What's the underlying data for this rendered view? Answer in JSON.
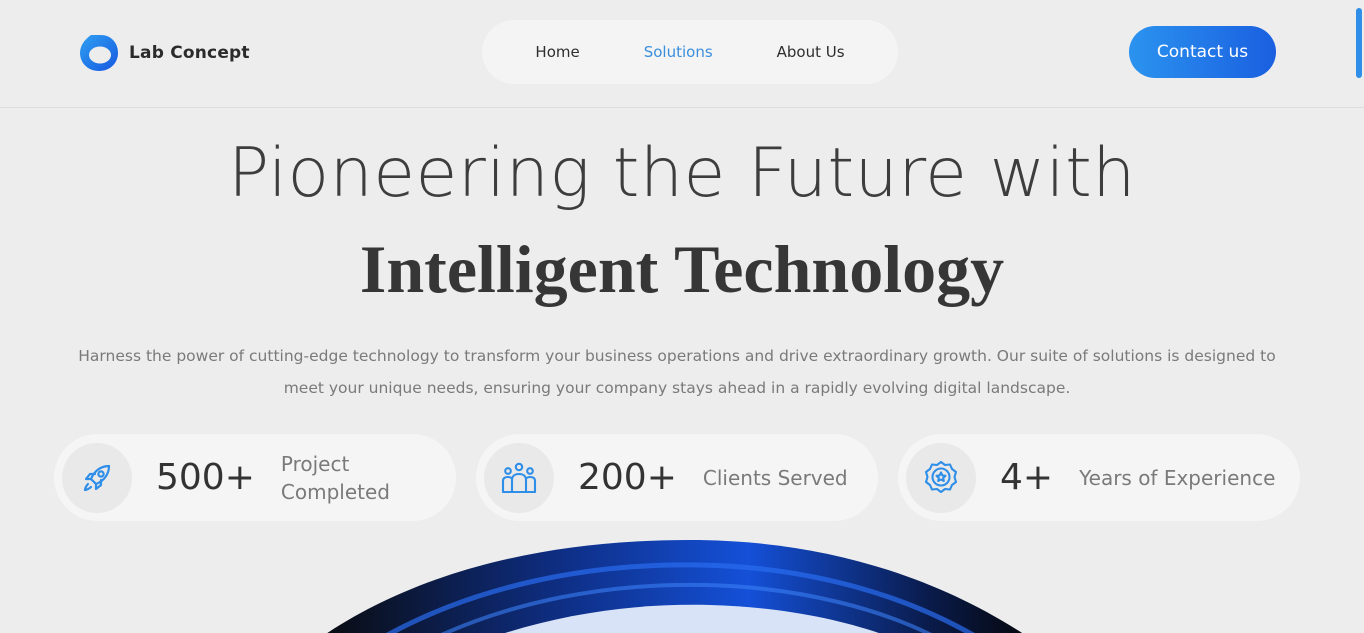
{
  "header": {
    "logo_text": "Lab Concept",
    "nav": [
      "Home",
      "Solutions",
      "About Us"
    ],
    "active_nav": "Solutions",
    "contact_label": "Contact us"
  },
  "hero": {
    "line1": "Pioneering the Future with",
    "line2": "Intelligent Technology",
    "description": "Harness the power of cutting-edge technology to transform your business operations and drive extraordinary growth. Our suite of solutions is designed to meet your unique needs, ensuring your company stays ahead in a rapidly evolving digital landscape."
  },
  "stats": [
    {
      "icon": "rocket-icon",
      "value": "500+",
      "label": "Project Completed"
    },
    {
      "icon": "clients-icon",
      "value": "200+",
      "label": "Clients Served"
    },
    {
      "icon": "badge-icon",
      "value": "4+",
      "label": "Years of Experience"
    }
  ],
  "colors": {
    "accent": "#2f8ee8",
    "accent_dark": "#1a5fe0",
    "background": "#ededed",
    "text": "#3a3a3a",
    "muted": "#7a7a7a"
  }
}
